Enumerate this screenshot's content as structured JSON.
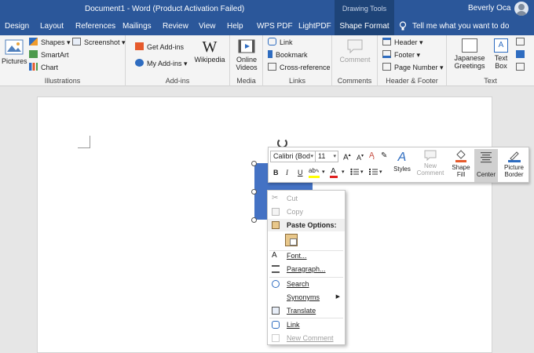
{
  "window": {
    "title": "Document1 - Word (Product Activation Failed)",
    "context_header": "Drawing Tools",
    "user": "Beverly Oca"
  },
  "tabs": [
    "Design",
    "Layout",
    "References",
    "Mailings",
    "Review",
    "View",
    "Help",
    "WPS PDF",
    "LightPDF",
    "Shape Format"
  ],
  "tell_me": "Tell me what you want to do",
  "ribbon": {
    "illustrations": {
      "label": "Illustrations",
      "pictures": "Pictures",
      "shapes": "Shapes",
      "smartart": "SmartArt",
      "chart": "Chart",
      "screenshot": "Screenshot"
    },
    "addins": {
      "label": "Add-ins",
      "get_addins": "Get Add-ins",
      "my_addins": "My Add-ins",
      "wikipedia": "Wikipedia"
    },
    "media": {
      "label": "Media",
      "online_videos_1": "Online",
      "online_videos_2": "Videos"
    },
    "links": {
      "label": "Links",
      "link": "Link",
      "bookmark": "Bookmark",
      "cross_reference": "Cross-reference"
    },
    "comments": {
      "label": "Comments",
      "comment": "Comment"
    },
    "header_footer": {
      "label": "Header & Footer",
      "header": "Header",
      "footer": "Footer",
      "page_number": "Page Number"
    },
    "text": {
      "label": "Text",
      "japanese_1": "Japanese",
      "japanese_2": "Greetings",
      "textbox_1": "Text",
      "textbox_2": "Box"
    }
  },
  "mini_toolbar": {
    "font_name": "Calibri (Bod",
    "font_size": "11",
    "bold": "B",
    "italic": "I",
    "underline": "U",
    "styles": "Styles",
    "new_comment_1": "New",
    "new_comment_2": "Comment",
    "shape_fill_1": "Shape",
    "shape_fill_2": "Fill",
    "center": "Center",
    "picture_border_1": "Picture",
    "picture_border_2": "Border",
    "highlight_color": "#ffff00",
    "font_color": "#e02020"
  },
  "context_menu": {
    "cut": "Cut",
    "copy": "Copy",
    "paste_options": "Paste Options:",
    "font": "Font...",
    "paragraph": "Paragraph...",
    "search": "Search",
    "synonyms": "Synonyms",
    "translate": "Translate",
    "link": "Link",
    "new_comment": "New Comment"
  },
  "colors": {
    "brand": "#2b579a",
    "shape_fill": "#4472c4",
    "context_tab": "#1e4478"
  }
}
